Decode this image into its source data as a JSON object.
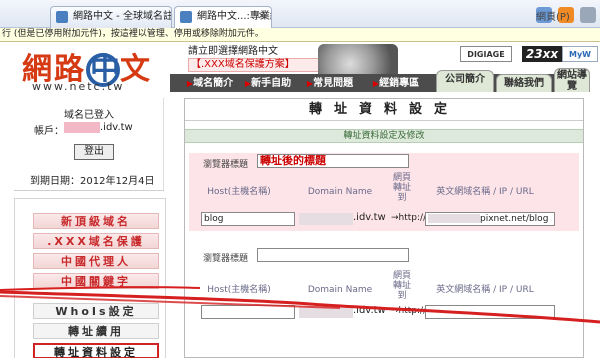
{
  "browser": {
    "tabs": [
      {
        "label": "網路中文 - 全球域名註冊..."
      },
      {
        "label": "網路中文...:專業網域..."
      }
    ],
    "toolbar_label": "網頁(P)"
  },
  "infobar": "行 (但是已停用附加元件)，按這裡以管理、停用或移除附加元件。",
  "site": {
    "logo_left": "網路",
    "logo_circle": "中",
    "logo_right": "文",
    "logo_url": "www.netc.tw",
    "banner_line1": "請立即選擇網路中文",
    "banner_line2": "【.XXX域名保護方案】",
    "badges": [
      "DIGIAGE",
      "23xx",
      "MyW"
    ]
  },
  "nav": {
    "items": [
      "域名簡介",
      "新手自助",
      "常見問題",
      "經銷專區"
    ],
    "tab_company": "公司簡介",
    "tab_contact": "聯絡我們",
    "tab_guide": "網站導覽"
  },
  "sidebar": {
    "login_title": "域名已登入",
    "account_label": "帳戶：",
    "account_domain": ".idv.tw",
    "logout_label": "登出",
    "expiry": "到期日期：2012年12月4日",
    "menu": [
      {
        "label": "新頂級域名",
        "style": "red"
      },
      {
        "label": ".XXX域名保護",
        "style": "red"
      },
      {
        "label": "中國代理人",
        "style": "red"
      },
      {
        "label": "中國關鍵字",
        "style": "red"
      },
      {
        "label": "WhoIs設定",
        "style": "plain"
      },
      {
        "label": "轉址續用",
        "style": "plain"
      },
      {
        "label": "轉址資料設定",
        "style": "active"
      }
    ]
  },
  "main": {
    "title": "轉址資料設定",
    "subtitle": "轉址資料設定及修改",
    "rows": [
      {
        "browser_title_label": "瀏覽器標題",
        "browser_title_value": "轉址後的標題",
        "host_head": "Host(主機名稱)",
        "domain_head": "Domain Name",
        "redirect_head": "網頁轉址到",
        "target_head": "英文網域名稱 / IP / URL",
        "host_value": "blog",
        "domain_suffix": ".idv.tw",
        "arrow": "→http://",
        "target_value": "pixnet.net/blog"
      },
      {
        "browser_title_label": "瀏覽器標題",
        "browser_title_value": "",
        "host_head": "Host(主機名稱)",
        "domain_head": "Domain Name",
        "redirect_head": "網頁轉址到",
        "target_head": "英文網域名稱 / IP / URL",
        "domain_suffix": ".idv.tw",
        "arrow": "→http://"
      }
    ]
  },
  "colors": {
    "logo_red": "#d63a12",
    "logo_blue": "#2a5fa5",
    "menu_red": "#c8292b",
    "annotation_red": "#d62020"
  }
}
